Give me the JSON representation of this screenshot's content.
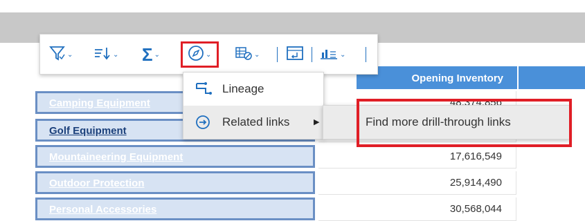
{
  "toolbar": {
    "buttons": [
      {
        "name": "filter",
        "icon": "filter-icon"
      },
      {
        "name": "sort",
        "icon": "sort-icon"
      },
      {
        "name": "summarize",
        "icon": "sigma-icon"
      },
      {
        "name": "explore",
        "icon": "compass-icon"
      },
      {
        "name": "suppress",
        "icon": "suppress-icon"
      },
      {
        "name": "pivot",
        "icon": "swap-icon"
      },
      {
        "name": "insert-chart",
        "icon": "chart-icon"
      }
    ],
    "accent_color": "#1f6fbf"
  },
  "menu": {
    "items": [
      {
        "label": "Lineage",
        "icon": "lineage-icon"
      },
      {
        "label": "Related links",
        "icon": "arrow-circle-icon",
        "has_submenu": true
      }
    ]
  },
  "submenu": {
    "items": [
      {
        "label": "Find more drill-through links"
      }
    ]
  },
  "table": {
    "column_header": "Opening Inventory",
    "rows": [
      {
        "label": "Camping Equipment",
        "value": "48,374,856"
      },
      {
        "label": "Golf Equipment",
        "value": ""
      },
      {
        "label": "Mountaineering Equipment",
        "value": "17,616,549"
      },
      {
        "label": "Outdoor Protection",
        "value": "25,914,490"
      },
      {
        "label": "Personal Accessories",
        "value": "30,568,044"
      }
    ]
  },
  "colors": {
    "highlight": "#e01e26",
    "header_bg": "#4a90d9",
    "row_bg": "#d7e3f3"
  }
}
